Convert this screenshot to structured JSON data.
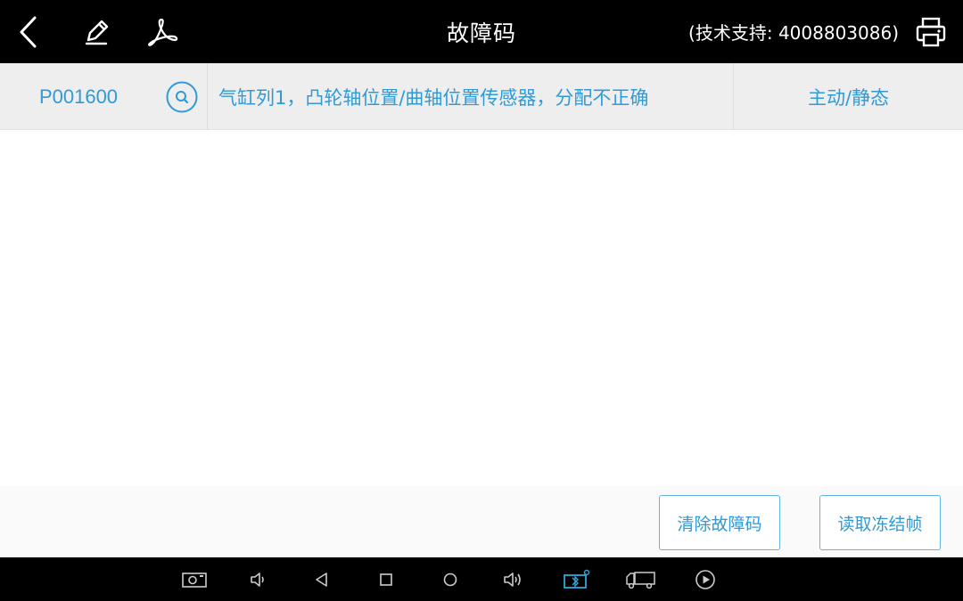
{
  "header": {
    "title": "故障码",
    "support": "(技术支持: 4008803086)",
    "icons": [
      "back-icon",
      "edit-icon",
      "pdf-icon",
      "print-icon"
    ]
  },
  "dtc": {
    "code": "P001600",
    "description": "气缸列1，凸轮轴位置/曲轴位置传感器，分配不正确",
    "status": "主动/静态"
  },
  "actions": {
    "clear_label": "清除故障码",
    "freeze_label": "读取冻结帧"
  },
  "navbar": {
    "icons": [
      "screenshot-icon",
      "volume-down-icon",
      "back-icon",
      "recents-icon",
      "home-icon",
      "volume-up-icon",
      "vci-connection-icon",
      "truck-icon",
      "play-icon"
    ]
  },
  "colors": {
    "accent": "#2f9ad6",
    "header_bg": "#000000",
    "row_bg": "#eeeeee"
  }
}
